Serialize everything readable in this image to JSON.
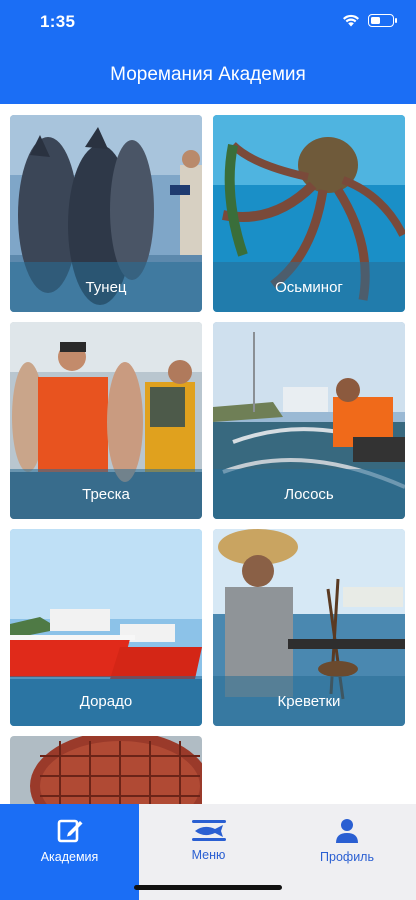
{
  "status_bar": {
    "time": "1:35"
  },
  "header": {
    "title": "Моремания Академия"
  },
  "cards": [
    {
      "label": "Тунец"
    },
    {
      "label": "Осьминог"
    },
    {
      "label": "Треска"
    },
    {
      "label": "Лосось"
    },
    {
      "label": "Дорадо"
    },
    {
      "label": "Креветки"
    },
    {
      "label": ""
    }
  ],
  "tabbar": {
    "tabs": [
      {
        "label": "Академия",
        "icon": "edit-icon",
        "active": true
      },
      {
        "label": "Меню",
        "icon": "fish-icon",
        "active": false
      },
      {
        "label": "Профиль",
        "icon": "person-icon",
        "active": false
      }
    ]
  },
  "colors": {
    "primary": "#1b6ef5",
    "tab_inactive": "#2a5fd2",
    "tabbar_bg": "#efeff2"
  }
}
